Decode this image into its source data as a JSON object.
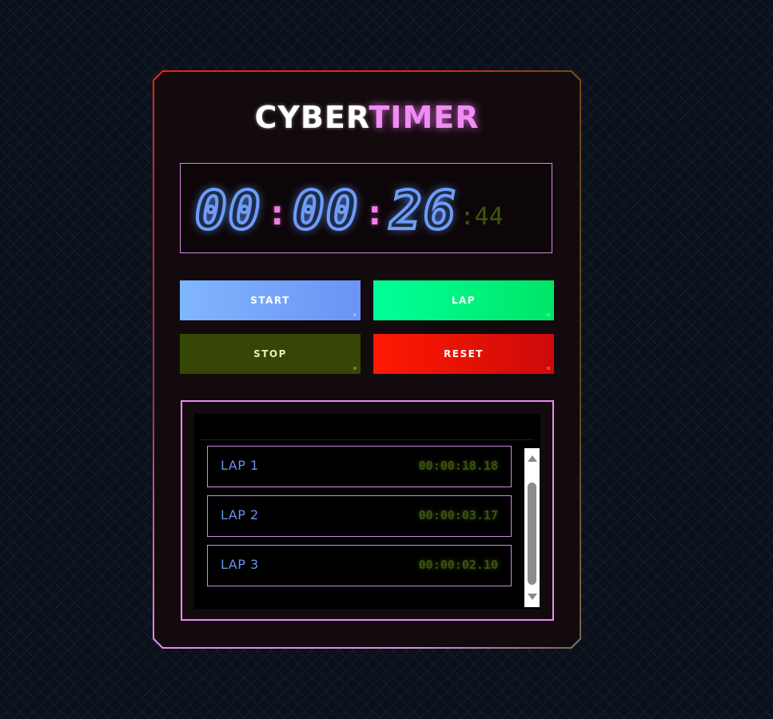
{
  "app": {
    "title_part1": "CYBER",
    "title_part2": "TIMER"
  },
  "timer": {
    "hours": "00",
    "minutes": "00",
    "seconds": "26",
    "separator": ":",
    "centiseconds": ":44"
  },
  "buttons": {
    "start": "START",
    "lap": "LAP",
    "stop": "STOP",
    "reset": "RESET"
  },
  "laps": [
    {
      "label": "LAP 1",
      "time": "00:00:18.18"
    },
    {
      "label": "LAP 2",
      "time": "00:00:03.17"
    },
    {
      "label": "LAP 3",
      "time": "00:00:02.10"
    }
  ],
  "colors": {
    "accent_pink": "#f28cf5",
    "digit_blue": "#6e9cf6",
    "lap_green": "#00ff99",
    "stop_olive": "#364604",
    "reset_red": "#ff1a00",
    "start_blue": "#80b6ff"
  },
  "icons": {
    "scroll_up": "triangle-up-icon",
    "scroll_down": "triangle-down-icon"
  }
}
